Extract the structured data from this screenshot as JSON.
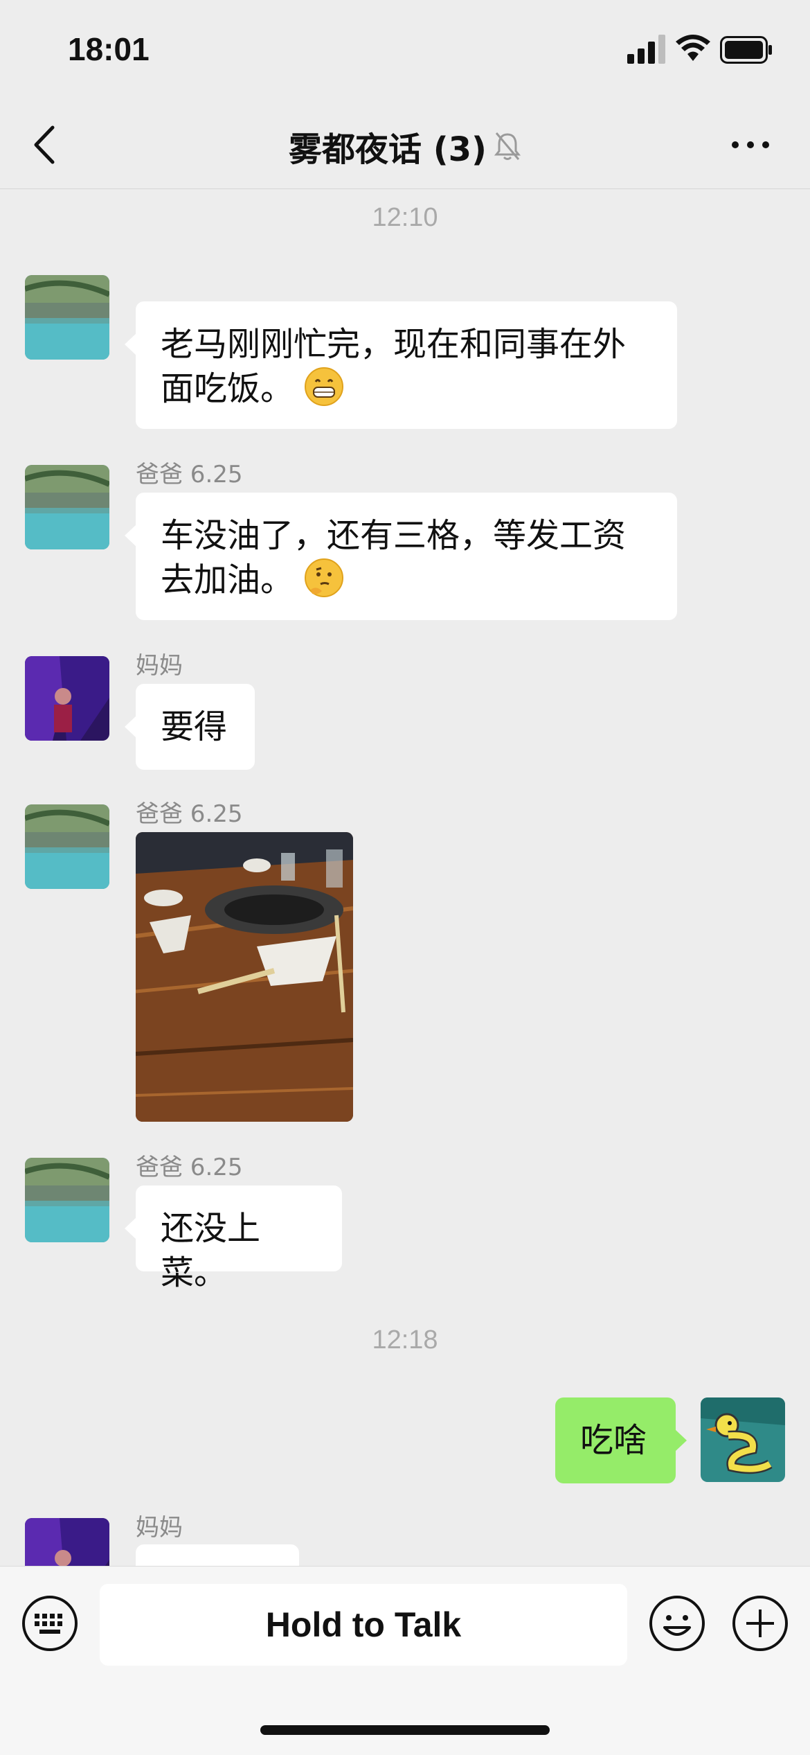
{
  "status_bar": {
    "time": "18:01"
  },
  "nav": {
    "title": "雾都夜话 (3)"
  },
  "messages": {
    "ts1": "12:10",
    "m1_text": "老马刚刚忙完，现在和同事在外面吃饭。",
    "m2_sender": "爸爸 6.25",
    "m2_text": "车没油了，还有三格，等发工资去加油。",
    "m3_sender": "妈妈",
    "m3_text": "要得",
    "m4_sender": "爸爸 6.25",
    "m5_sender": "爸爸 6.25",
    "m5_text": "还没上菜。",
    "ts2": "12:18",
    "m6_text": "吃啥",
    "m7_sender": "妈妈"
  },
  "input": {
    "hold_to_talk": "Hold to Talk"
  },
  "colors": {
    "background": "#ededed",
    "sent_bubble": "#95ec69",
    "received_bubble": "#ffffff"
  },
  "icons": [
    "back-icon",
    "muted-bell-icon",
    "more-icon",
    "keyboard-icon",
    "emoji-icon",
    "plus-icon",
    "signal-icon",
    "wifi-icon",
    "battery-icon"
  ]
}
